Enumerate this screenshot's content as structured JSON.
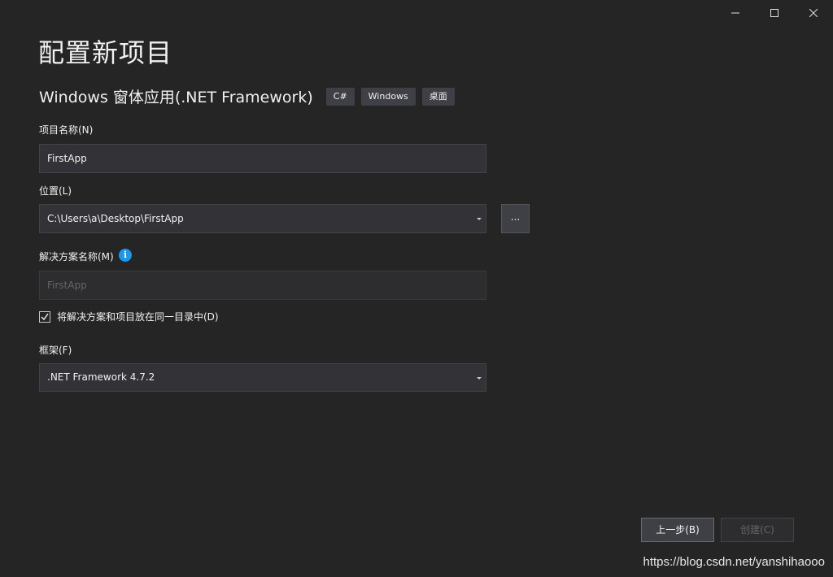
{
  "window": {
    "minimize_icon": "minimize-icon",
    "maximize_icon": "maximize-icon",
    "close_icon": "close-icon"
  },
  "page": {
    "title": "配置新项目",
    "subtitle": "Windows 窗体应用(.NET Framework)",
    "tags": [
      "C#",
      "Windows",
      "桌面"
    ]
  },
  "form": {
    "project_name": {
      "label": "项目名称(N)",
      "value": "FirstApp"
    },
    "location": {
      "label": "位置(L)",
      "value": "C:\\Users\\a\\Desktop\\FirstApp",
      "browse_label": "..."
    },
    "solution_name": {
      "label": "解决方案名称(M)",
      "placeholder": "FirstApp",
      "info_icon": "info-icon"
    },
    "same_directory": {
      "label": "将解决方案和项目放在同一目录中(D)",
      "checked": true
    },
    "framework": {
      "label": "框架(F)",
      "value": ".NET Framework 4.7.2"
    }
  },
  "buttons": {
    "back": "上一步(B)",
    "create": "创建(C)"
  },
  "watermark": "https://blog.csdn.net/yanshihaooo",
  "colors": {
    "background": "#252526",
    "field_bg": "#333337",
    "tag_bg": "#3f3f46",
    "info_blue": "#1c97ea",
    "text": "#f1f1f1",
    "disabled_text": "#656565"
  }
}
